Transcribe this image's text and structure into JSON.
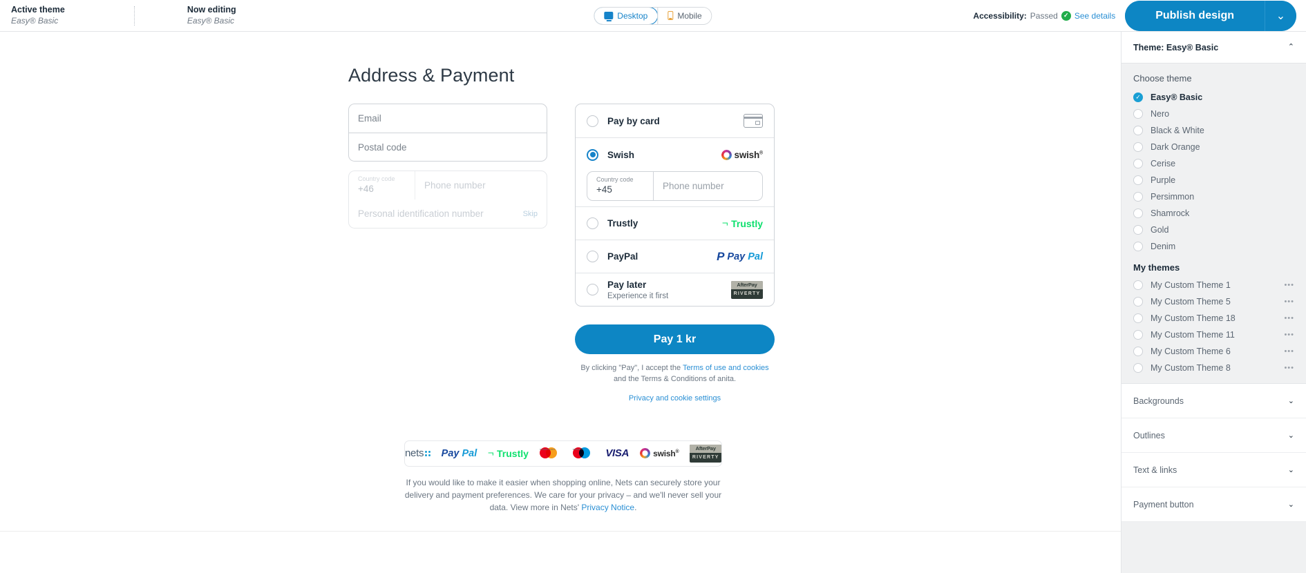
{
  "topbar": {
    "active_theme_label": "Active theme",
    "active_theme_value": "Easy® Basic",
    "now_editing_label": "Now editing",
    "now_editing_value": "Easy® Basic",
    "viewport": {
      "desktop": "Desktop",
      "mobile": "Mobile",
      "selected": "Desktop"
    },
    "accessibility_label": "Accessibility:",
    "accessibility_status": "Passed",
    "see_details": "See details",
    "publish_button": "Publish design"
  },
  "checkout": {
    "title": "Address & Payment",
    "address_fields": [
      {
        "placeholder": "Email"
      },
      {
        "placeholder": "Postal code"
      }
    ],
    "phone": {
      "country_code_label": "Country code",
      "country_code_value": "+46",
      "phone_placeholder": "Phone number"
    },
    "personal_id": {
      "placeholder": "Personal identification number",
      "skip": "Skip"
    },
    "payment_methods": [
      {
        "label": "Pay by card",
        "sublabel": "",
        "logo": "card-icon",
        "selected": false
      },
      {
        "label": "Swish",
        "sublabel": "",
        "logo": "swish-logo",
        "selected": true
      },
      {
        "label": "Trustly",
        "sublabel": "",
        "logo": "trustly-logo",
        "selected": false
      },
      {
        "label": "PayPal",
        "sublabel": "",
        "logo": "paypal-logo",
        "selected": false
      },
      {
        "label": "Pay later",
        "sublabel": "Experience it first",
        "logo": "afterpay-riverty-logo",
        "selected": false
      }
    ],
    "swish_phone": {
      "country_code_label": "Country code",
      "country_code_value": "+45",
      "phone_placeholder": "Phone number"
    },
    "pay_button": "Pay 1 kr",
    "terms_prefix": "By clicking \"Pay\", I accept the ",
    "terms_link": "Terms of use and cookies",
    "terms_suffix": " and the Terms & Conditions of anita.",
    "privacy_settings_link": "Privacy and cookie settings",
    "footer_logos": [
      "nets",
      "PayPal",
      "Trustly",
      "mastercard",
      "maestro",
      "VISA",
      "swish",
      "AfterPay RIVERTY"
    ],
    "footer_note_part1": "If you would like to make it easier when shopping online, Nets can securely store your delivery and payment preferences. We care for your privacy – and we'll never sell your data. View more in Nets' ",
    "footer_note_link": "Privacy Notice",
    "footer_note_part2": "."
  },
  "panel": {
    "header_title": "Theme: Easy® Basic",
    "choose_theme_label": "Choose theme",
    "themes": [
      {
        "label": "Easy® Basic",
        "selected": true
      },
      {
        "label": "Nero",
        "selected": false
      },
      {
        "label": "Black & White",
        "selected": false
      },
      {
        "label": "Dark Orange",
        "selected": false
      },
      {
        "label": "Cerise",
        "selected": false
      },
      {
        "label": "Purple",
        "selected": false
      },
      {
        "label": "Persimmon",
        "selected": false
      },
      {
        "label": "Shamrock",
        "selected": false
      },
      {
        "label": "Gold",
        "selected": false
      },
      {
        "label": "Denim",
        "selected": false
      }
    ],
    "my_themes_label": "My themes",
    "my_themes": [
      {
        "label": "My Custom Theme 1",
        "menu": "•••"
      },
      {
        "label": "My Custom Theme 5",
        "menu": "•••"
      },
      {
        "label": "My Custom Theme 18",
        "menu": "•••"
      },
      {
        "label": "My Custom Theme 11",
        "menu": "•••"
      },
      {
        "label": "My Custom Theme 6",
        "menu": "•••"
      },
      {
        "label": "My Custom Theme 8",
        "menu": "•••"
      }
    ],
    "accordions": [
      {
        "label": "Backgrounds"
      },
      {
        "label": "Outlines"
      },
      {
        "label": "Text & links"
      },
      {
        "label": "Payment button"
      }
    ]
  },
  "colors": {
    "brand_blue": "#0d86c4",
    "accent_blue": "#1a9fd4",
    "link_blue": "#2a8fd4",
    "success_green": "#22ac4b",
    "panel_bg": "#f0f1f2",
    "text_dark": "#1c2b39",
    "text_muted": "#6b7682"
  }
}
